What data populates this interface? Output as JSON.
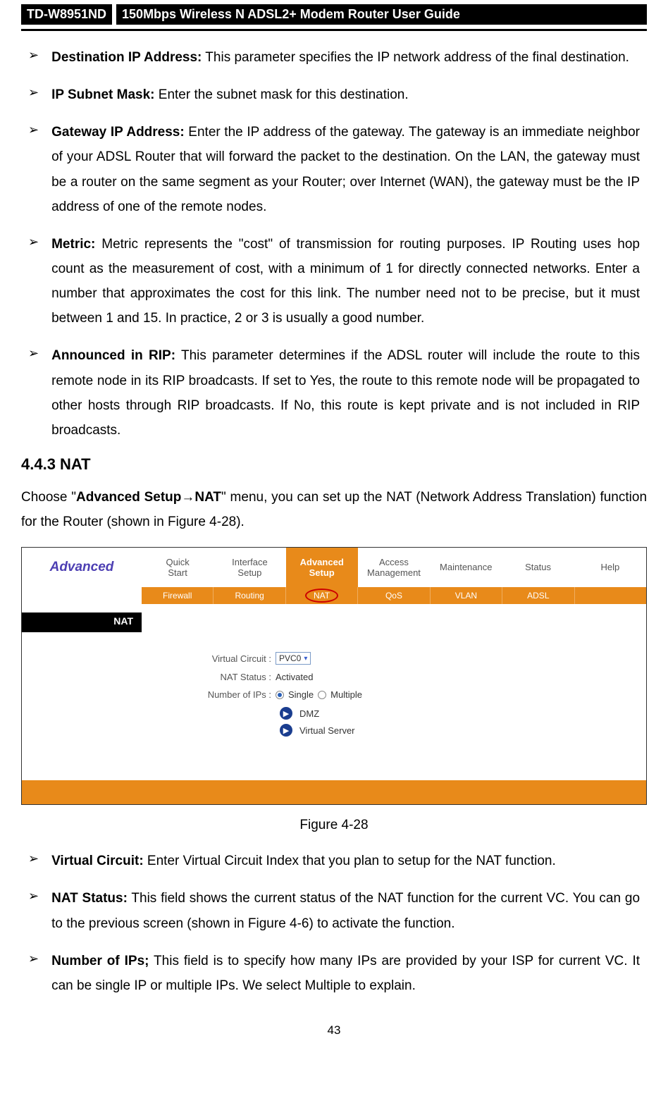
{
  "header": {
    "model": "TD-W8951ND",
    "title": "150Mbps Wireless N ADSL2+ Modem Router User Guide"
  },
  "topList": [
    {
      "term": "Destination IP Address:",
      "desc": " This parameter specifies the IP network address of the final destination."
    },
    {
      "term": "IP Subnet Mask:",
      "desc": " Enter the subnet mask for this destination."
    },
    {
      "term": "Gateway IP Address:",
      "desc": " Enter the IP address of the gateway. The gateway is an immediate neighbor of your ADSL Router that will forward the packet to the destination. On the LAN, the gateway must be a router on the same segment as your Router; over Internet (WAN), the gateway must be the IP address of one of the remote nodes."
    },
    {
      "term": "Metric:",
      "desc": " Metric represents the \"cost\" of transmission for routing purposes. IP Routing uses hop count as the measurement of cost, with a minimum of 1 for directly connected networks. Enter a number that approximates the cost for this link. The number need not to be precise, but it must between 1 and 15. In practice, 2 or 3 is usually a good number."
    },
    {
      "term": "Announced in RIP:",
      "desc": " This parameter determines if the ADSL router will include the route to this remote node in its RIP broadcasts. If set to Yes, the route to this remote node will be propagated to other hosts through RIP broadcasts. If No, this route is kept private and is not included in RIP broadcasts."
    }
  ],
  "sectionHeading": "4.4.3  NAT",
  "introPara": {
    "prefix": "Choose \"",
    "boldPath": "Advanced Setup→NAT",
    "suffix": "\" menu, you can set up the NAT (Network Address Translation) function for the Router (shown in Figure 4-28)."
  },
  "figure": {
    "sidebarTitle": "Advanced",
    "tabs": [
      "Quick Start",
      "Interface Setup",
      "Advanced Setup",
      "Access Management",
      "Maintenance",
      "Status",
      "Help"
    ],
    "activeTabIndex": 2,
    "subtabs": [
      "Firewall",
      "Routing",
      "NAT",
      "QoS",
      "VLAN",
      "ADSL",
      ""
    ],
    "activeSubtabIndex": 2,
    "natLabel": "NAT",
    "rows": {
      "vcLabel": "Virtual Circuit :",
      "vcValue": "PVC0",
      "natStatusLabel": "NAT Status :",
      "natStatusValue": "Activated",
      "numIpsLabel": "Number of IPs :",
      "singleLabel": "Single",
      "multipleLabel": "Multiple",
      "dmzLabel": "DMZ",
      "vsLabel": "Virtual Server"
    }
  },
  "figureCaption": "Figure 4-28",
  "bottomList": [
    {
      "term": "Virtual Circuit:",
      "desc": " Enter Virtual Circuit Index that you plan to setup for the NAT function."
    },
    {
      "term": "NAT Status:",
      "desc": " This field shows the current status of the NAT function for the current VC. You can go to the previous screen (shown in Figure 4-6) to activate the function."
    },
    {
      "term": "Number of IPs;",
      "desc": " This field is to specify how many IPs are provided by your ISP for current VC. It can be single IP or multiple IPs. We select Multiple to explain."
    }
  ],
  "pageNumber": "43"
}
